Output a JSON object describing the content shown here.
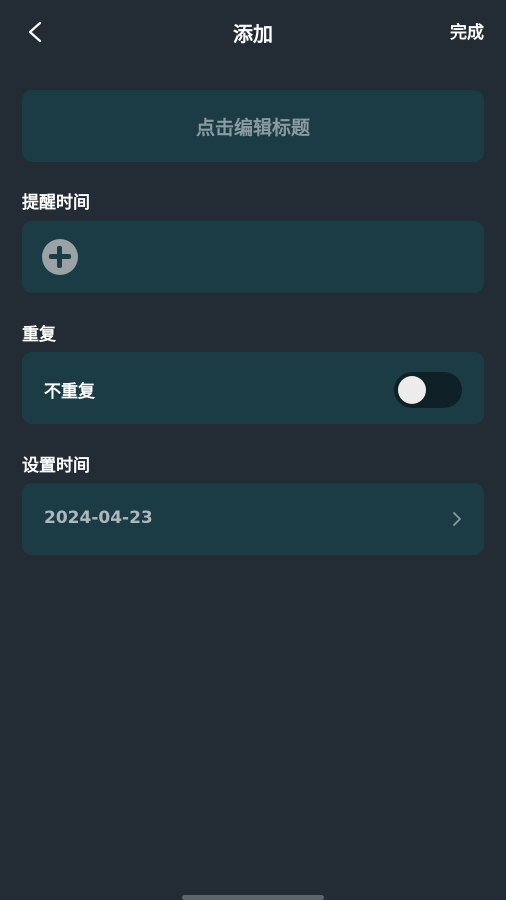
{
  "header": {
    "title": "添加",
    "done_label": "完成"
  },
  "title_card": {
    "placeholder": "点击编辑标题"
  },
  "reminder": {
    "label": "提醒时间"
  },
  "repeat": {
    "label": "重复",
    "value": "不重复",
    "toggle_on": false
  },
  "set_time": {
    "label": "设置时间",
    "date": "2024-04-23"
  },
  "colors": {
    "background": "#232c35",
    "card": "#1b3c45",
    "text": "#ffffff",
    "muted_text": "#8a9aa0"
  },
  "icons": {
    "back": "chevron-left-icon",
    "add": "plus-circle-icon",
    "forward": "chevron-right-icon"
  }
}
